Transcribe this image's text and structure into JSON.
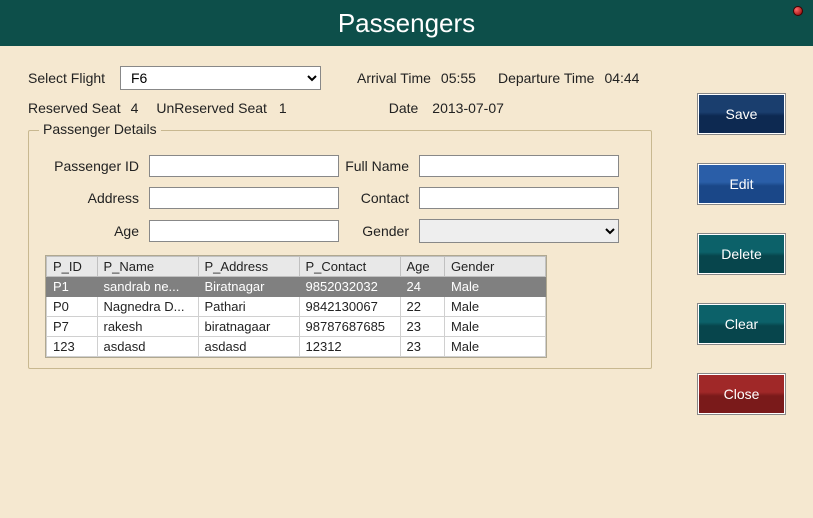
{
  "header": {
    "title": "Passengers"
  },
  "flight": {
    "select_label": "Select Flight",
    "selected": "F6",
    "arrival_label": "Arrival Time",
    "arrival_value": "05:55",
    "departure_label": "Departure Time",
    "departure_value": "04:44",
    "reserved_label": "Reserved Seat",
    "reserved_value": "4",
    "unreserved_label": "UnReserved Seat",
    "unreserved_value": "1",
    "date_label": "Date",
    "date_value": "2013-07-07"
  },
  "details": {
    "legend": "Passenger Details",
    "labels": {
      "pid": "Passenger ID",
      "fullname": "Full Name",
      "address": "Address",
      "contact": "Contact",
      "age": "Age",
      "gender": "Gender"
    },
    "values": {
      "pid": "",
      "fullname": "",
      "address": "",
      "contact": "",
      "age": "",
      "gender": ""
    }
  },
  "table": {
    "headers": [
      "P_ID",
      "P_Name",
      "P_Address",
      "P_Contact",
      "Age",
      "Gender"
    ],
    "rows": [
      {
        "pid": "P1",
        "name": "sandrab ne...",
        "addr": "Biratnagar",
        "contact": "9852032032",
        "age": "24",
        "gender": "Male",
        "selected": true
      },
      {
        "pid": "P0",
        "name": "Nagnedra D...",
        "addr": "Pathari",
        "contact": "9842130067",
        "age": "22",
        "gender": "Male",
        "selected": false
      },
      {
        "pid": "P7",
        "name": "rakesh",
        "addr": "biratnagaar",
        "contact": "98787687685",
        "age": "23",
        "gender": "Male",
        "selected": false
      },
      {
        "pid": "123",
        "name": "asdasd",
        "addr": "asdasd",
        "contact": "12312",
        "age": "23",
        "gender": "Male",
        "selected": false
      }
    ]
  },
  "buttons": {
    "save": "Save",
    "edit": "Edit",
    "delete": "Delete",
    "clear": "Clear",
    "close": "Close"
  }
}
